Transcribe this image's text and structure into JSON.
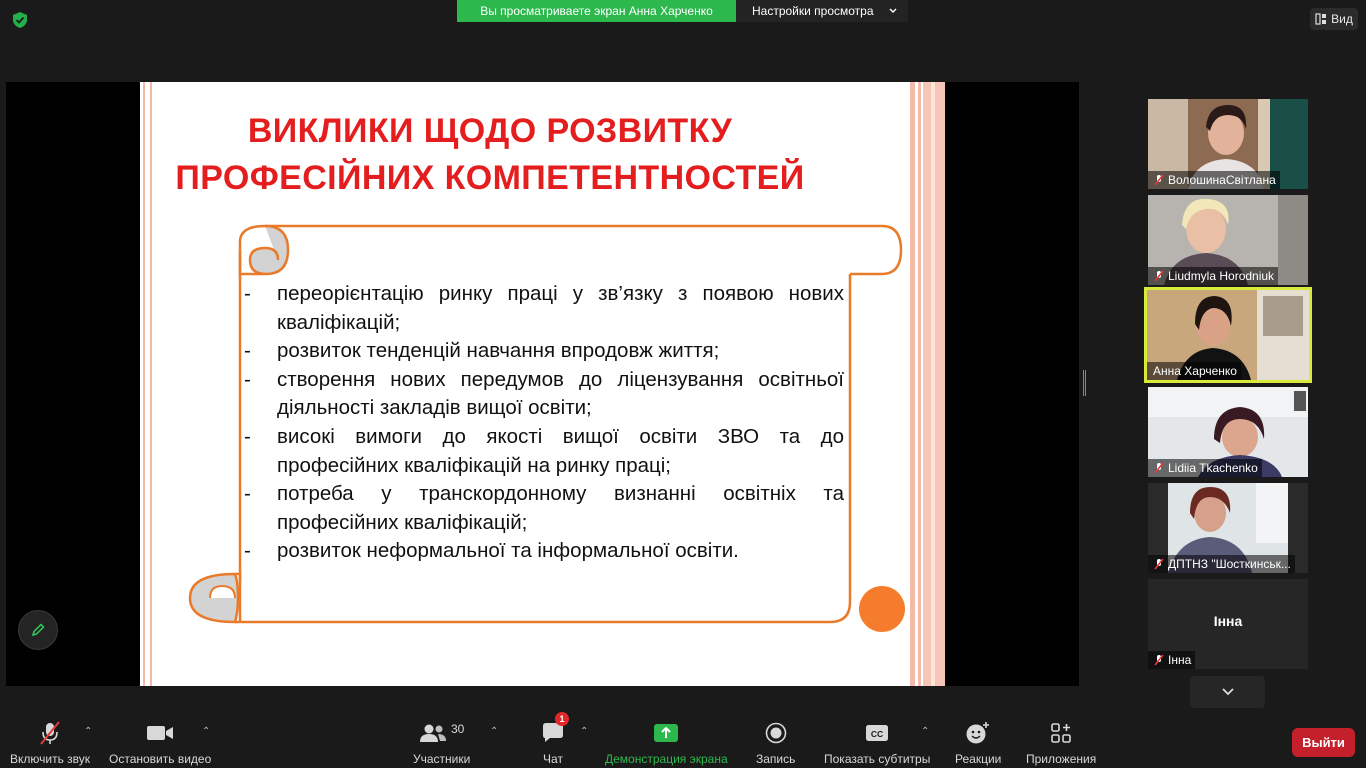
{
  "top": {
    "share_banner_text": "Вы просматриваете экран Анна Харченко",
    "view_options_label": "Настройки просмотра",
    "view_button_label": "Вид"
  },
  "slide": {
    "title_line1": "ВИКЛИКИ ЩОДО РОЗВИТКУ",
    "title_line2": "ПРОФЕСІЙНИХ КОМПЕТЕНТНОСТЕЙ",
    "bullets": [
      {
        "dash": "-",
        "text": "переорієнтацію ринку праці у зв’язку з появою нових кваліфікацій;"
      },
      {
        "dash": "-",
        "text": "розвиток тенденцій навчання впродовж життя;"
      },
      {
        "dash": "-",
        "text": "створення нових передумов до ліцензування освітньої діяльності закладів вищої освіти;"
      },
      {
        "dash": "-",
        "text": "високі вимоги до якості вищої освіти ЗВО та до професійних кваліфікацій на ринку праці;"
      },
      {
        "dash": "-",
        "text": "потреба у транскордонному визнанні освітніх та професійних кваліфікацій;"
      },
      {
        "dash": "-",
        "text": "розвиток неформальної та інформальної освіти."
      }
    ]
  },
  "participants": [
    {
      "name": "ВолошинаСвітлана",
      "muted": true
    },
    {
      "name": "Liudmyla Horodniuk",
      "muted": true
    },
    {
      "name": "Анна Харченко",
      "muted": false,
      "active": true
    },
    {
      "name": "Lidiia Tkachenko",
      "muted": true
    },
    {
      "name": "ДПТНЗ \"Шосткинськ...",
      "muted": true
    },
    {
      "name": "Інна",
      "muted": true,
      "center_name": "Інна"
    }
  ],
  "toolbar": {
    "unmute_label": "Включить звук",
    "stop_video_label": "Остановить видео",
    "participants_label": "Участники",
    "participants_count": "30",
    "chat_label": "Чат",
    "chat_badge": "1",
    "share_label": "Демонстрация экрана",
    "record_label": "Запись",
    "captions_label": "Показать субтитры",
    "reactions_label": "Реакции",
    "apps_label": "Приложения",
    "leave_label": "Выйти"
  },
  "colors": {
    "share_green": "#2db84d",
    "slide_title_red": "#e41e1e",
    "scroll_orange": "#e87a2a",
    "active_speaker_border": "#d9ea3a",
    "leave_red": "#c4202b"
  }
}
